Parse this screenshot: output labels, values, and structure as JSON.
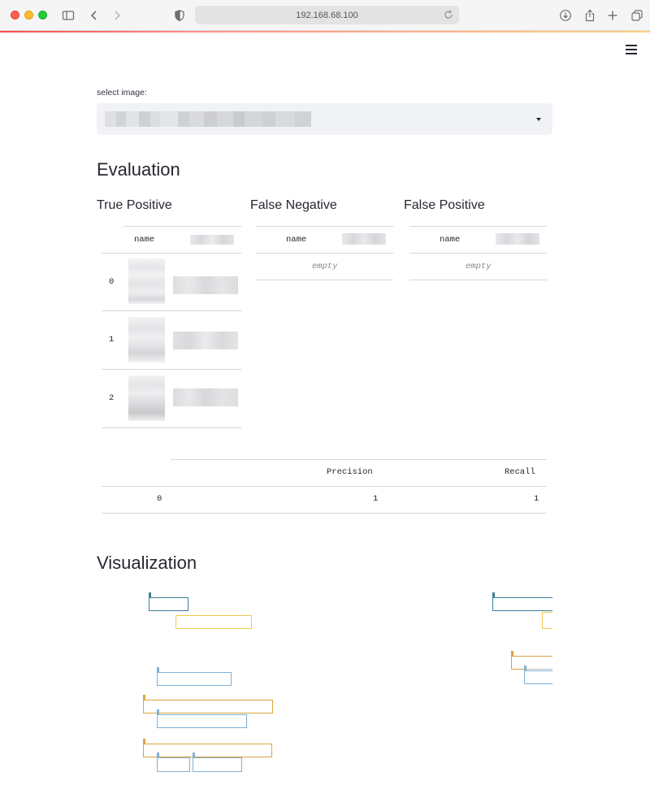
{
  "browser": {
    "url": "192.168.68.100"
  },
  "select": {
    "label": "select image:",
    "value_redacted": true
  },
  "evaluation": {
    "title": "Evaluation",
    "true_positive": {
      "title": "True Positive",
      "header_name": "name",
      "rows": [
        {
          "index": "0"
        },
        {
          "index": "1"
        },
        {
          "index": "2"
        }
      ]
    },
    "false_negative": {
      "title": "False Negative",
      "header_name": "name",
      "empty_text": "empty"
    },
    "false_positive": {
      "title": "False Positive",
      "header_name": "name",
      "empty_text": "empty"
    },
    "metrics": {
      "headers": [
        "Precision",
        "Recall"
      ],
      "rows": [
        {
          "index": "0",
          "precision": "1",
          "recall": "1"
        }
      ]
    }
  },
  "visualization": {
    "title": "Visualization",
    "colors": {
      "blue": "#7fb1d6",
      "teal": "#3d7f9c",
      "yellow": "#f2c94c",
      "orange": "#dba13e"
    }
  }
}
